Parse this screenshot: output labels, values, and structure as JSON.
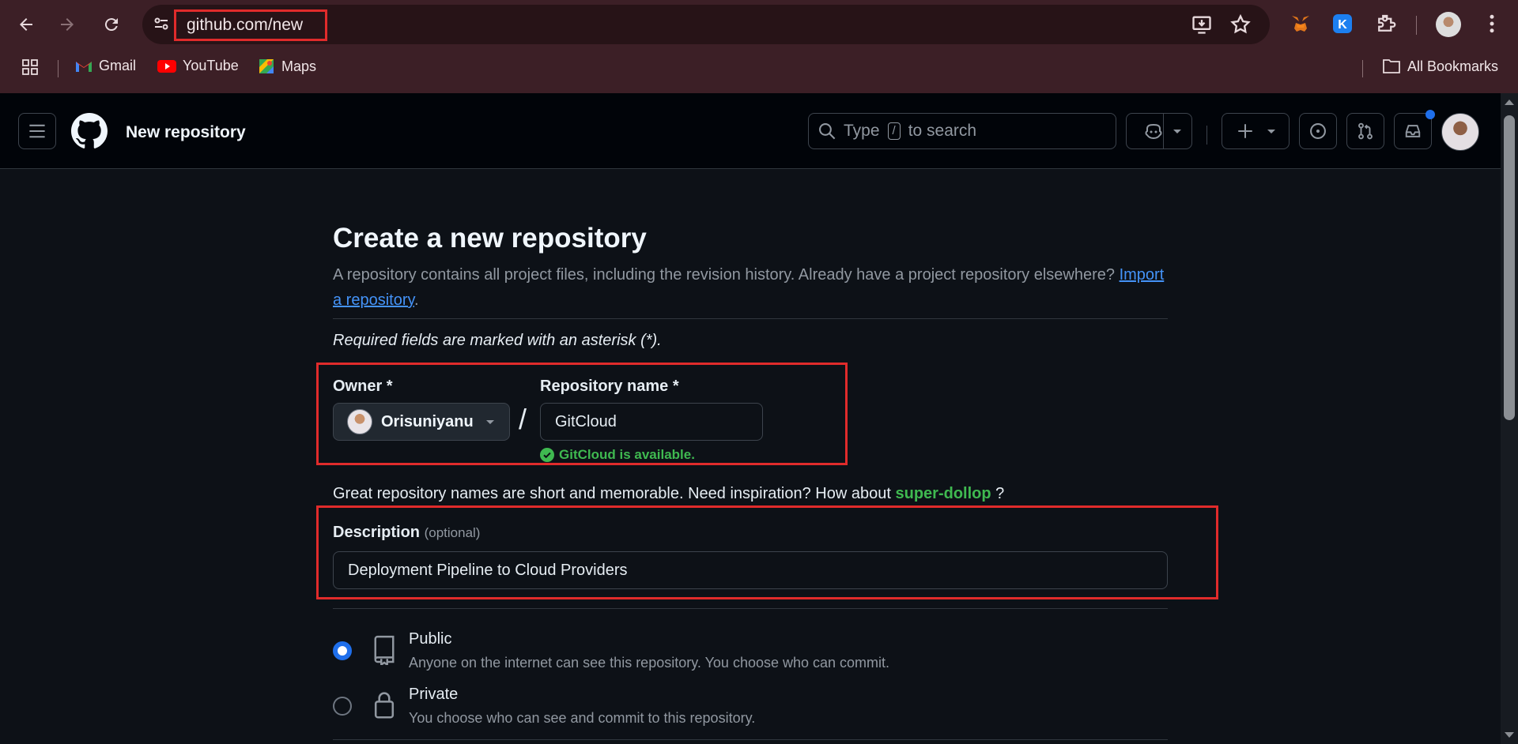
{
  "browser": {
    "url": "github.com/new",
    "bookmarks": [
      {
        "label": "Gmail",
        "icon": "gmail-icon"
      },
      {
        "label": "YouTube",
        "icon": "youtube-icon"
      },
      {
        "label": "Maps",
        "icon": "maps-icon"
      }
    ],
    "all_bookmarks": "All Bookmarks"
  },
  "header": {
    "title": "New repository",
    "search_prefix": "Type",
    "search_key": "/",
    "search_suffix": "to search"
  },
  "page": {
    "heading": "Create a new repository",
    "subtitle": "A repository contains all project files, including the revision history. Already have a project repository elsewhere?",
    "import_link": "Import a repository",
    "import_after": ".",
    "required_note": "Required fields are marked with an asterisk (*).",
    "owner_label": "Owner *",
    "owner_value": "Orisuniyanu",
    "slash": "/",
    "repo_name_label": "Repository name *",
    "repo_name_value": "GitCloud",
    "availability": "GitCloud is available.",
    "inspiration_text": "Great repository names are short and memorable. Need inspiration? How about",
    "suggestion": "super-dollop",
    "inspiration_end": "?",
    "description_label": "Description",
    "description_optional": "(optional)",
    "description_value": "Deployment Pipeline to Cloud Providers",
    "visibility": [
      {
        "title": "Public",
        "desc": "Anyone on the internet can see this repository. You choose who can commit.",
        "checked": true
      },
      {
        "title": "Private",
        "desc": "You choose who can see and commit to this repository.",
        "checked": false
      }
    ]
  },
  "colors": {
    "accent_blue": "#1f6feb",
    "success_green": "#3fb950",
    "highlight_red": "#e02b2b",
    "browser_frame": "#3c1f26"
  }
}
